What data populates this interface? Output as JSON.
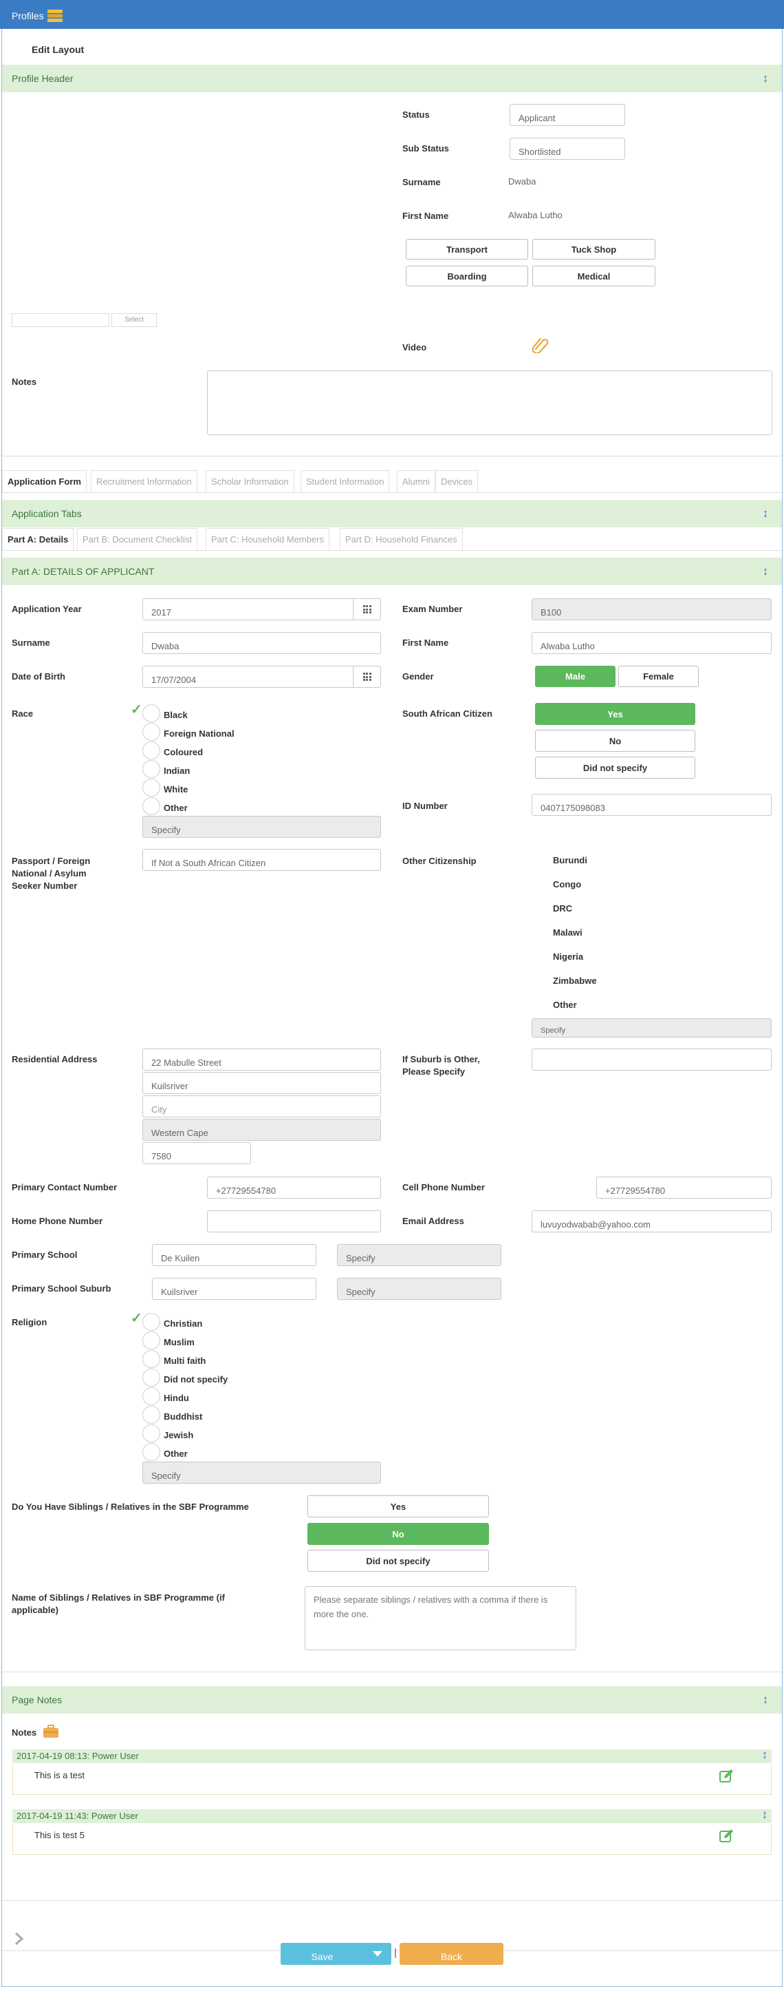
{
  "header": {
    "title": "Profiles",
    "edit_layout": "Edit Layout"
  },
  "colors": {
    "topbar": "#3a7dc4",
    "panel_bg": "#dff0d8",
    "panel_text": "#3c763d",
    "selected": "#5cb85c",
    "save": "#5bc0de",
    "back": "#f0ad4e"
  },
  "profile": {
    "panel_title": "Profile Header",
    "status_label": "Status",
    "status_value": "Applicant",
    "substatus_label": "Sub Status",
    "substatus_value": "Shortlisted",
    "surname_label": "Surname",
    "surname_value": "Dwaba",
    "firstname_label": "First Name",
    "firstname_value": "Alwaba Lutho",
    "buttons": [
      "Transport",
      "Tuck Shop",
      "Boarding",
      "Medical"
    ],
    "select_label": "Select",
    "video_label": "Video",
    "notes_label": "Notes"
  },
  "tabs": [
    "Application Form",
    "Recruitment Information",
    "Scholar Information",
    "Student Information",
    "Alumni",
    "Devices"
  ],
  "app_tabs": {
    "panel_title": "Application Tabs",
    "tabs": [
      "Part A: Details",
      "Part B: Document Checklist",
      "Part C: Household Members",
      "Part D: Household Finances"
    ]
  },
  "part_a": {
    "panel_title": "Part A: DETAILS OF APPLICANT",
    "app_year_label": "Application Year",
    "app_year": "2017",
    "exam_label": "Exam Number",
    "exam": "B100",
    "surname_label": "Surname",
    "surname": "Dwaba",
    "firstname_label": "First Name",
    "firstname": "Alwaba Lutho",
    "dob_label": "Date of Birth",
    "dob": "17/07/2004",
    "gender_label": "Gender",
    "gender_male": "Male",
    "gender_female": "Female",
    "race_label": "Race",
    "race_options": [
      "Black",
      "Foreign National",
      "Coloured",
      "Indian",
      "White",
      "Other"
    ],
    "race_specify": "Specify",
    "sa_citizen_label": "South African Citizen",
    "sa_options": [
      "Yes",
      "No",
      "Did not specify"
    ],
    "id_label": "ID Number",
    "id": "0407175098083",
    "passport_label": "Passport / Foreign National / Asylum Seeker Number",
    "passport_placeholder": "If Not a South African Citizen",
    "other_cit_label": "Other Citizenship",
    "other_cit_options": [
      "Burundi",
      "Congo",
      "DRC",
      "Malawi",
      "Nigeria",
      "Zimbabwe",
      "Other"
    ],
    "other_cit_specify": "Specify",
    "res_label": "Residential Address",
    "res_street": "22 Mabulle Street",
    "res_suburb": "Kuilsriver",
    "res_city": "City",
    "res_province": "Western Cape",
    "res_code": "7580",
    "suburb_other_label": "If Suburb is Other, Please Specify",
    "primary_contact_label": "Primary Contact Number",
    "primary_contact": "+27729554780",
    "cell_label": "Cell Phone Number",
    "cell": "+27729554780",
    "home_phone_label": "Home Phone Number",
    "email_label": "Email Address",
    "email": "luvuyodwabab@yahoo.com",
    "primary_school_label": "Primary School",
    "primary_school": "De Kuilen",
    "primary_school_specify": "Specify",
    "primary_suburb_label": "Primary School Suburb",
    "primary_suburb": "Kuilsriver",
    "primary_suburb_specify": "Specify",
    "religion_label": "Religion",
    "religion_options": [
      "Christian",
      "Muslim",
      "Multi faith",
      "Did not specify",
      "Hindu",
      "Buddhist",
      "Jewish",
      "Other"
    ],
    "religion_specify": "Specify",
    "siblings_label": "Do You Have Siblings / Relatives in the SBF Programme",
    "siblings_options": [
      "Yes",
      "No",
      "Did not specify"
    ],
    "sibling_names_label": "Name of Siblings / Relatives in SBF Programme (if applicable)",
    "sibling_names_placeholder": "Please separate siblings / relatives with a comma if there is more the one."
  },
  "page_notes": {
    "panel_title": "Page Notes",
    "notes_label": "Notes",
    "items": [
      {
        "header": "2017-04-19 08:13: Power User",
        "text": "This is a test"
      },
      {
        "header": "2017-04-19 11:43: Power User",
        "text": "This is test 5"
      }
    ]
  },
  "footer": {
    "save": "Save",
    "back": "Back"
  }
}
